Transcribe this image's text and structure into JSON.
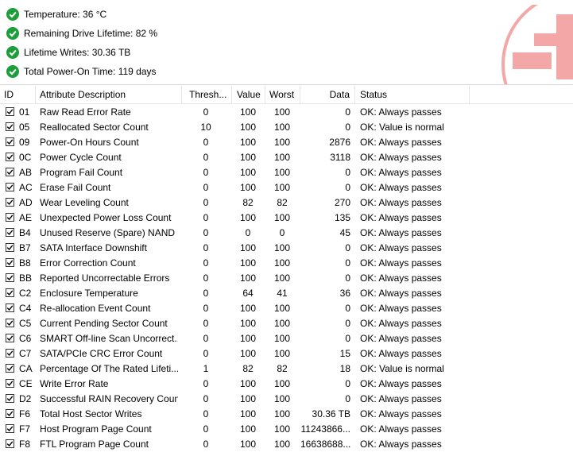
{
  "summary": {
    "temperature": "Temperature: 36 °C",
    "lifetime": "Remaining Drive Lifetime: 82 %",
    "writes": "Lifetime Writes: 30.36 TB",
    "power_on": "Total Power-On Time: 119 days"
  },
  "colors": {
    "ok_green": "#1e9e3a",
    "logo_pink": "#f4a7a7"
  },
  "table": {
    "headers": {
      "id": "ID",
      "desc": "Attribute Description",
      "threshold": "Thresh...",
      "value": "Value",
      "worst": "Worst",
      "data": "Data",
      "status": "Status"
    },
    "rows": [
      {
        "id": "01",
        "desc": "Raw Read Error Rate",
        "threshold": "0",
        "value": "100",
        "worst": "100",
        "data": "0",
        "status": "OK: Always passes"
      },
      {
        "id": "05",
        "desc": "Reallocated Sector Count",
        "threshold": "10",
        "value": "100",
        "worst": "100",
        "data": "0",
        "status": "OK: Value is normal"
      },
      {
        "id": "09",
        "desc": "Power-On Hours Count",
        "threshold": "0",
        "value": "100",
        "worst": "100",
        "data": "2876",
        "status": "OK: Always passes"
      },
      {
        "id": "0C",
        "desc": "Power Cycle Count",
        "threshold": "0",
        "value": "100",
        "worst": "100",
        "data": "3118",
        "status": "OK: Always passes"
      },
      {
        "id": "AB",
        "desc": "Program Fail Count",
        "threshold": "0",
        "value": "100",
        "worst": "100",
        "data": "0",
        "status": "OK: Always passes"
      },
      {
        "id": "AC",
        "desc": "Erase Fail Count",
        "threshold": "0",
        "value": "100",
        "worst": "100",
        "data": "0",
        "status": "OK: Always passes"
      },
      {
        "id": "AD",
        "desc": "Wear Leveling Count",
        "threshold": "0",
        "value": "82",
        "worst": "82",
        "data": "270",
        "status": "OK: Always passes"
      },
      {
        "id": "AE",
        "desc": "Unexpected Power Loss Count",
        "threshold": "0",
        "value": "100",
        "worst": "100",
        "data": "135",
        "status": "OK: Always passes"
      },
      {
        "id": "B4",
        "desc": "Unused Reserve (Spare) NAND ...",
        "threshold": "0",
        "value": "0",
        "worst": "0",
        "data": "45",
        "status": "OK: Always passes"
      },
      {
        "id": "B7",
        "desc": "SATA Interface Downshift",
        "threshold": "0",
        "value": "100",
        "worst": "100",
        "data": "0",
        "status": "OK: Always passes"
      },
      {
        "id": "B8",
        "desc": "Error Correction Count",
        "threshold": "0",
        "value": "100",
        "worst": "100",
        "data": "0",
        "status": "OK: Always passes"
      },
      {
        "id": "BB",
        "desc": "Reported Uncorrectable Errors",
        "threshold": "0",
        "value": "100",
        "worst": "100",
        "data": "0",
        "status": "OK: Always passes"
      },
      {
        "id": "C2",
        "desc": "Enclosure Temperature",
        "threshold": "0",
        "value": "64",
        "worst": "41",
        "data": "36",
        "status": "OK: Always passes"
      },
      {
        "id": "C4",
        "desc": "Re-allocation Event Count",
        "threshold": "0",
        "value": "100",
        "worst": "100",
        "data": "0",
        "status": "OK: Always passes"
      },
      {
        "id": "C5",
        "desc": "Current Pending Sector Count",
        "threshold": "0",
        "value": "100",
        "worst": "100",
        "data": "0",
        "status": "OK: Always passes"
      },
      {
        "id": "C6",
        "desc": "SMART Off-line Scan Uncorrect...",
        "threshold": "0",
        "value": "100",
        "worst": "100",
        "data": "0",
        "status": "OK: Always passes"
      },
      {
        "id": "C7",
        "desc": "SATA/PCIe CRC Error Count",
        "threshold": "0",
        "value": "100",
        "worst": "100",
        "data": "15",
        "status": "OK: Always passes"
      },
      {
        "id": "CA",
        "desc": "Percentage Of The Rated Lifeti...",
        "threshold": "1",
        "value": "82",
        "worst": "82",
        "data": "18",
        "status": "OK: Value is normal"
      },
      {
        "id": "CE",
        "desc": "Write Error Rate",
        "threshold": "0",
        "value": "100",
        "worst": "100",
        "data": "0",
        "status": "OK: Always passes"
      },
      {
        "id": "D2",
        "desc": "Successful RAIN Recovery Count",
        "threshold": "0",
        "value": "100",
        "worst": "100",
        "data": "0",
        "status": "OK: Always passes"
      },
      {
        "id": "F6",
        "desc": "Total Host Sector Writes",
        "threshold": "0",
        "value": "100",
        "worst": "100",
        "data": "30.36 TB",
        "status": "OK: Always passes"
      },
      {
        "id": "F7",
        "desc": "Host Program Page Count",
        "threshold": "0",
        "value": "100",
        "worst": "100",
        "data": "11243866...",
        "status": "OK: Always passes"
      },
      {
        "id": "F8",
        "desc": "FTL Program Page Count",
        "threshold": "0",
        "value": "100",
        "worst": "100",
        "data": "16638688...",
        "status": "OK: Always passes"
      }
    ]
  }
}
